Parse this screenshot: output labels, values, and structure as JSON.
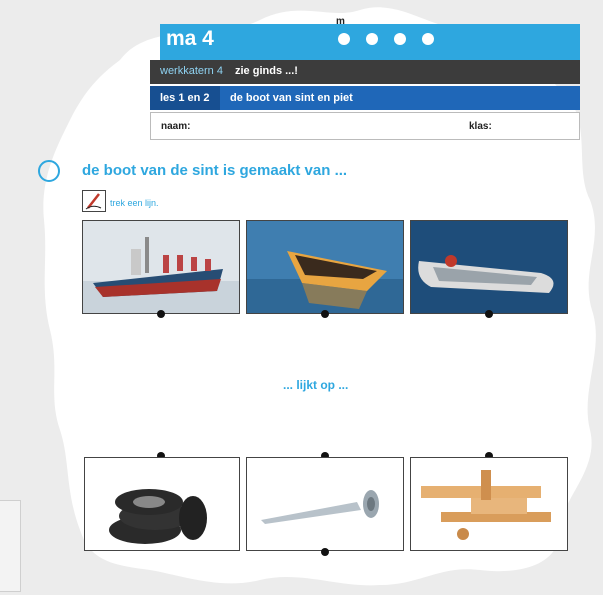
{
  "header": {
    "theme_title": "ma 4",
    "theme_top_text": "m",
    "book_label": "werkkatern 4",
    "book_title": "zie ginds ...!",
    "lesson_label": "les 1 en 2",
    "lesson_title": "de boot van sint en piet"
  },
  "form": {
    "name_label": "naam:",
    "class_label": "klas:"
  },
  "exercise": {
    "number": "",
    "question": "de boot van de sint is gemaakt van ...",
    "instruction": "trek een lijn.",
    "subheading": "... lijkt op ..."
  },
  "images": {
    "top": [
      "cargo-ship",
      "wooden-rowboat",
      "inflatable-boat"
    ],
    "bottom": [
      "car-tires",
      "metal-screw",
      "wooden-toy-airplane"
    ]
  },
  "colors": {
    "accent": "#2ea7df",
    "dark_bar": "#3c3c3c",
    "lesson_bar": "#1f67b8"
  }
}
